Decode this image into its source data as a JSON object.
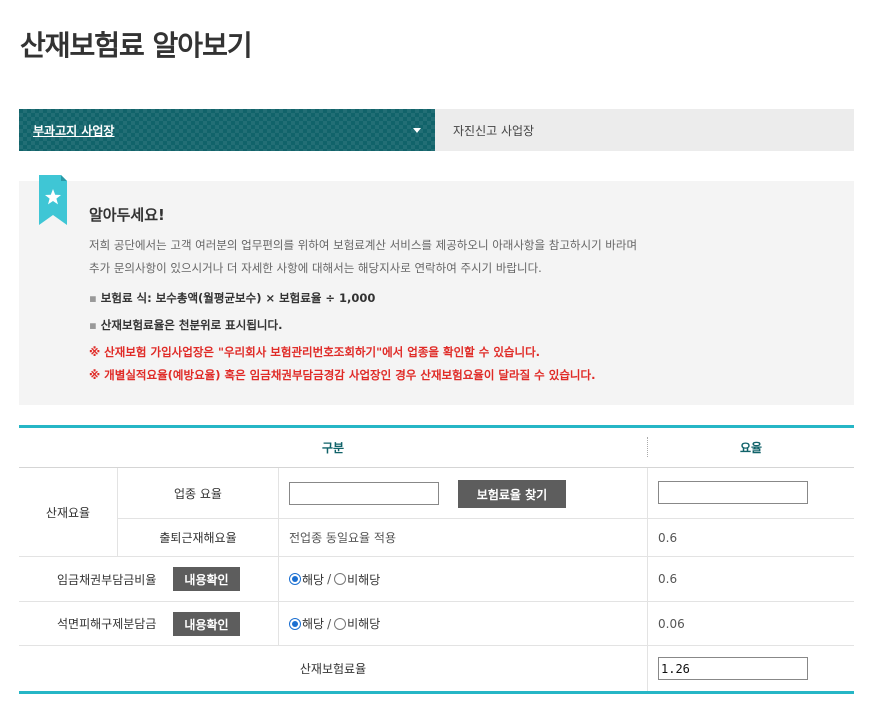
{
  "page": {
    "title": "산재보험료 알아보기"
  },
  "tabs": [
    {
      "label": "부과고지 사업장",
      "active": true
    },
    {
      "label": "자진신고 사업장",
      "active": false
    }
  ],
  "notice": {
    "title": "알아두세요!",
    "desc_lines": [
      "저희 공단에서는 고객 여러분의 업무편의를 위하여 보험료계산 서비스를 제공하오니 아래사항을 참고하시기 바라며",
      "추가 문의사항이 있으시거나 더 자세한 사항에 대해서는 해당지사로 연락하여 주시기 바랍니다."
    ],
    "bullets": [
      "보험료 식: 보수총액(월평균보수) × 보험료율 ÷ 1,000",
      "산재보험료율은 천분위로 표시됩니다."
    ],
    "warnings": [
      "※ 산재보험 가입사업장은 \"우리회사 보험관리번호조회하기\"에서 업종을 확인할 수 있습니다.",
      "※ 개별실적요율(예방요율) 혹은 임금채권부담금경감 사업장인 경우 산재보험요율이 달라질 수 있습니다."
    ],
    "colors": {
      "accent": "#26b6c6",
      "warning": "#e02b27"
    }
  },
  "table": {
    "header": {
      "category": "구분",
      "rate": "요율"
    },
    "group_label": "산재요율",
    "rows": {
      "industry": {
        "label": "업종 요율",
        "input_value": "",
        "button": "보험료율 찾기",
        "rate_value": ""
      },
      "commute": {
        "label": "출퇴근재해요율",
        "note": "전업종 동일요율 적용",
        "rate": "0.6"
      },
      "wage": {
        "label": "임금채권부담금비율",
        "button": "내용확인",
        "opt_yes": "해당",
        "opt_no": "비해당",
        "separator": "/",
        "selected": "해당",
        "rate": "0.6"
      },
      "asbestos": {
        "label": "석면피해구제분담금",
        "button": "내용확인",
        "opt_yes": "해당",
        "opt_no": "비해당",
        "separator": "/",
        "selected": "해당",
        "rate": "0.06"
      },
      "total": {
        "label": "산재보험료율",
        "value": "1.26"
      }
    }
  }
}
